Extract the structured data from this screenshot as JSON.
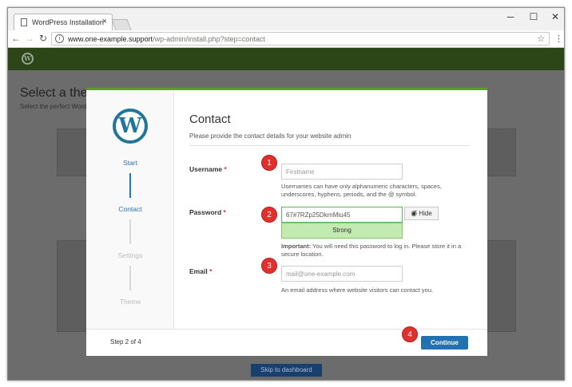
{
  "browser": {
    "tab_title": "WordPress Installation",
    "tab_close": "×",
    "controls": {
      "minimize": "─",
      "maximize": "☐",
      "close": "✕"
    },
    "nav": {
      "back": "←",
      "forward": "→",
      "reload": "↻"
    },
    "url_host": "www.one-example.support",
    "url_path": "/wp-admin/install.php?step=contact",
    "info": "i",
    "star": "☆",
    "menu": "⋮"
  },
  "background": {
    "heading": "Select a then",
    "subheading": "Select the perfect Word",
    "skip_label": "Skip to dashboard"
  },
  "modal": {
    "logo": "W",
    "steps": [
      {
        "label": "Start"
      },
      {
        "label": "Contact"
      },
      {
        "label": "Settings"
      },
      {
        "label": "Theme"
      }
    ],
    "title": "Contact",
    "description": "Please provide the contact details for your website admin",
    "required_mark": "*",
    "username": {
      "label": "Username",
      "placeholder": "Firstname",
      "hint": "Usernames can have only alphanumeric characters, spaces, underscores, hyphens, periods, and the @ symbol."
    },
    "password": {
      "label": "Password",
      "value": "67#7RZp25DkrnMiu45",
      "hide_label": "Hide",
      "strength": "Strong",
      "hint_bold": "Important:",
      "hint": "You will need this password to log in. Please store it in a secure location."
    },
    "email": {
      "label": "Email",
      "placeholder": "mail@one-example.com",
      "hint": "An email address where website visitors can contact you."
    },
    "step_count": "Step 2 of 4",
    "continue_label": "Continue"
  },
  "badges": [
    "1",
    "2",
    "3",
    "4"
  ],
  "colors": {
    "accent_blue": "#2271b1",
    "wp_green": "#5b9c31",
    "strength_green": "#c3ebb1",
    "badge_red": "#e0302d"
  }
}
